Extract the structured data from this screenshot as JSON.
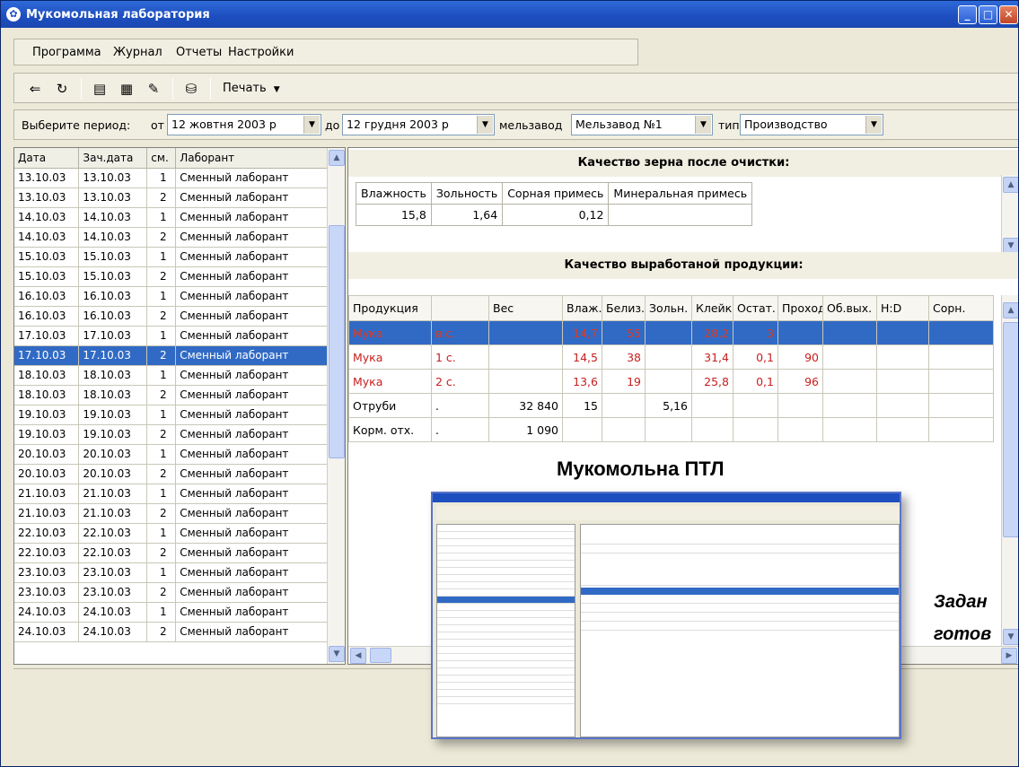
{
  "window": {
    "title": "Мукомольная лаборатория"
  },
  "menu": [
    "Программа",
    "Журнал",
    "Отчеты",
    "Настройки"
  ],
  "toolbar": {
    "print_label": "Печать"
  },
  "filter": {
    "period_label": "Выберите период:",
    "from_label": "от",
    "from_value": "12   жовтня   2003 р",
    "to_label": "до",
    "to_value": "12   грудня   2003 р",
    "mill_label": "мельзавод",
    "mill_value": "Мельзавод №1",
    "type_label": "тип",
    "type_value": "Производство"
  },
  "journal": {
    "columns": [
      "Дата",
      "Зач.дата",
      "см.",
      "Лаборант"
    ],
    "rows": [
      [
        "13.10.03",
        "13.10.03",
        "1",
        "Сменный лаборант"
      ],
      [
        "13.10.03",
        "13.10.03",
        "2",
        "Сменный лаборант"
      ],
      [
        "14.10.03",
        "14.10.03",
        "1",
        "Сменный лаборант"
      ],
      [
        "14.10.03",
        "14.10.03",
        "2",
        "Сменный лаборант"
      ],
      [
        "15.10.03",
        "15.10.03",
        "1",
        "Сменный лаборант"
      ],
      [
        "15.10.03",
        "15.10.03",
        "2",
        "Сменный лаборант"
      ],
      [
        "16.10.03",
        "16.10.03",
        "1",
        "Сменный лаборант"
      ],
      [
        "16.10.03",
        "16.10.03",
        "2",
        "Сменный лаборант"
      ],
      [
        "17.10.03",
        "17.10.03",
        "1",
        "Сменный лаборант"
      ],
      [
        "17.10.03",
        "17.10.03",
        "2",
        "Сменный лаборант"
      ],
      [
        "18.10.03",
        "18.10.03",
        "1",
        "Сменный лаборант"
      ],
      [
        "18.10.03",
        "18.10.03",
        "2",
        "Сменный лаборант"
      ],
      [
        "19.10.03",
        "19.10.03",
        "1",
        "Сменный лаборант"
      ],
      [
        "19.10.03",
        "19.10.03",
        "2",
        "Сменный лаборант"
      ],
      [
        "20.10.03",
        "20.10.03",
        "1",
        "Сменный лаборант"
      ],
      [
        "20.10.03",
        "20.10.03",
        "2",
        "Сменный лаборант"
      ],
      [
        "21.10.03",
        "21.10.03",
        "1",
        "Сменный лаборант"
      ],
      [
        "21.10.03",
        "21.10.03",
        "2",
        "Сменный лаборант"
      ],
      [
        "22.10.03",
        "22.10.03",
        "1",
        "Сменный лаборант"
      ],
      [
        "22.10.03",
        "22.10.03",
        "2",
        "Сменный лаборант"
      ],
      [
        "23.10.03",
        "23.10.03",
        "1",
        "Сменный лаборант"
      ],
      [
        "23.10.03",
        "23.10.03",
        "2",
        "Сменный лаборант"
      ],
      [
        "24.10.03",
        "24.10.03",
        "1",
        "Сменный лаборант"
      ],
      [
        "24.10.03",
        "24.10.03",
        "2",
        "Сменный лаборант"
      ]
    ],
    "selected_index": 9
  },
  "grain": {
    "title": "Качество зерна после очистки:",
    "columns": [
      "Влажность",
      "Зольность",
      "Сорная примесь",
      "Минеральная примесь"
    ],
    "values": [
      "15,8",
      "1,64",
      "0,12",
      ""
    ]
  },
  "products": {
    "title": "Качество выработаной продукции:",
    "columns": [
      "Продукция",
      "",
      "Вес",
      "Влаж.",
      "Белиз.",
      "Зольн.",
      "Клейк.",
      "Остат.",
      "Проход",
      "Об.вых.",
      "H:D",
      "Сорн."
    ],
    "rows": [
      [
        "Мука",
        "в.с.",
        "",
        "14,7",
        "55",
        "",
        "28,2",
        "3",
        "",
        "",
        "",
        ""
      ],
      [
        "Мука",
        "1 с.",
        "",
        "14,5",
        "38",
        "",
        "31,4",
        "0,1",
        "90",
        "",
        "",
        ""
      ],
      [
        "Мука",
        "2 с.",
        "",
        "13,6",
        "19",
        "",
        "25,8",
        "0,1",
        "96",
        "",
        "",
        ""
      ],
      [
        "Отруби",
        ".",
        "32 840",
        "15",
        "",
        "5,16",
        "",
        "",
        "",
        "",
        "",
        ""
      ],
      [
        "Корм. отх.",
        ".",
        "1 090",
        "",
        "",
        "",
        "",
        "",
        "",
        "",
        "",
        ""
      ]
    ]
  },
  "overlay": {
    "caption": "Мукомольна ПТЛ",
    "side_line1": "Задан",
    "side_line2": "готов"
  }
}
